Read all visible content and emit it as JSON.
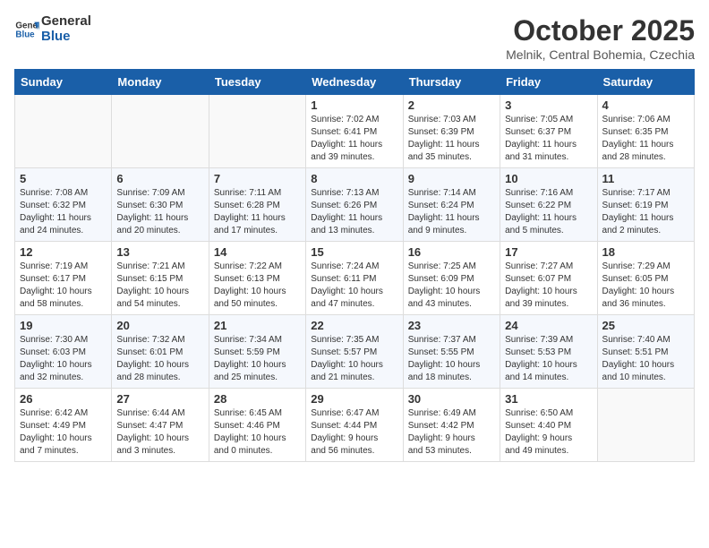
{
  "header": {
    "logo_line1": "General",
    "logo_line2": "Blue",
    "month_title": "October 2025",
    "subtitle": "Melnik, Central Bohemia, Czechia"
  },
  "weekdays": [
    "Sunday",
    "Monday",
    "Tuesday",
    "Wednesday",
    "Thursday",
    "Friday",
    "Saturday"
  ],
  "weeks": [
    [
      {
        "day": "",
        "info": ""
      },
      {
        "day": "",
        "info": ""
      },
      {
        "day": "",
        "info": ""
      },
      {
        "day": "1",
        "info": "Sunrise: 7:02 AM\nSunset: 6:41 PM\nDaylight: 11 hours\nand 39 minutes."
      },
      {
        "day": "2",
        "info": "Sunrise: 7:03 AM\nSunset: 6:39 PM\nDaylight: 11 hours\nand 35 minutes."
      },
      {
        "day": "3",
        "info": "Sunrise: 7:05 AM\nSunset: 6:37 PM\nDaylight: 11 hours\nand 31 minutes."
      },
      {
        "day": "4",
        "info": "Sunrise: 7:06 AM\nSunset: 6:35 PM\nDaylight: 11 hours\nand 28 minutes."
      }
    ],
    [
      {
        "day": "5",
        "info": "Sunrise: 7:08 AM\nSunset: 6:32 PM\nDaylight: 11 hours\nand 24 minutes."
      },
      {
        "day": "6",
        "info": "Sunrise: 7:09 AM\nSunset: 6:30 PM\nDaylight: 11 hours\nand 20 minutes."
      },
      {
        "day": "7",
        "info": "Sunrise: 7:11 AM\nSunset: 6:28 PM\nDaylight: 11 hours\nand 17 minutes."
      },
      {
        "day": "8",
        "info": "Sunrise: 7:13 AM\nSunset: 6:26 PM\nDaylight: 11 hours\nand 13 minutes."
      },
      {
        "day": "9",
        "info": "Sunrise: 7:14 AM\nSunset: 6:24 PM\nDaylight: 11 hours\nand 9 minutes."
      },
      {
        "day": "10",
        "info": "Sunrise: 7:16 AM\nSunset: 6:22 PM\nDaylight: 11 hours\nand 5 minutes."
      },
      {
        "day": "11",
        "info": "Sunrise: 7:17 AM\nSunset: 6:19 PM\nDaylight: 11 hours\nand 2 minutes."
      }
    ],
    [
      {
        "day": "12",
        "info": "Sunrise: 7:19 AM\nSunset: 6:17 PM\nDaylight: 10 hours\nand 58 minutes."
      },
      {
        "day": "13",
        "info": "Sunrise: 7:21 AM\nSunset: 6:15 PM\nDaylight: 10 hours\nand 54 minutes."
      },
      {
        "day": "14",
        "info": "Sunrise: 7:22 AM\nSunset: 6:13 PM\nDaylight: 10 hours\nand 50 minutes."
      },
      {
        "day": "15",
        "info": "Sunrise: 7:24 AM\nSunset: 6:11 PM\nDaylight: 10 hours\nand 47 minutes."
      },
      {
        "day": "16",
        "info": "Sunrise: 7:25 AM\nSunset: 6:09 PM\nDaylight: 10 hours\nand 43 minutes."
      },
      {
        "day": "17",
        "info": "Sunrise: 7:27 AM\nSunset: 6:07 PM\nDaylight: 10 hours\nand 39 minutes."
      },
      {
        "day": "18",
        "info": "Sunrise: 7:29 AM\nSunset: 6:05 PM\nDaylight: 10 hours\nand 36 minutes."
      }
    ],
    [
      {
        "day": "19",
        "info": "Sunrise: 7:30 AM\nSunset: 6:03 PM\nDaylight: 10 hours\nand 32 minutes."
      },
      {
        "day": "20",
        "info": "Sunrise: 7:32 AM\nSunset: 6:01 PM\nDaylight: 10 hours\nand 28 minutes."
      },
      {
        "day": "21",
        "info": "Sunrise: 7:34 AM\nSunset: 5:59 PM\nDaylight: 10 hours\nand 25 minutes."
      },
      {
        "day": "22",
        "info": "Sunrise: 7:35 AM\nSunset: 5:57 PM\nDaylight: 10 hours\nand 21 minutes."
      },
      {
        "day": "23",
        "info": "Sunrise: 7:37 AM\nSunset: 5:55 PM\nDaylight: 10 hours\nand 18 minutes."
      },
      {
        "day": "24",
        "info": "Sunrise: 7:39 AM\nSunset: 5:53 PM\nDaylight: 10 hours\nand 14 minutes."
      },
      {
        "day": "25",
        "info": "Sunrise: 7:40 AM\nSunset: 5:51 PM\nDaylight: 10 hours\nand 10 minutes."
      }
    ],
    [
      {
        "day": "26",
        "info": "Sunrise: 6:42 AM\nSunset: 4:49 PM\nDaylight: 10 hours\nand 7 minutes."
      },
      {
        "day": "27",
        "info": "Sunrise: 6:44 AM\nSunset: 4:47 PM\nDaylight: 10 hours\nand 3 minutes."
      },
      {
        "day": "28",
        "info": "Sunrise: 6:45 AM\nSunset: 4:46 PM\nDaylight: 10 hours\nand 0 minutes."
      },
      {
        "day": "29",
        "info": "Sunrise: 6:47 AM\nSunset: 4:44 PM\nDaylight: 9 hours\nand 56 minutes."
      },
      {
        "day": "30",
        "info": "Sunrise: 6:49 AM\nSunset: 4:42 PM\nDaylight: 9 hours\nand 53 minutes."
      },
      {
        "day": "31",
        "info": "Sunrise: 6:50 AM\nSunset: 4:40 PM\nDaylight: 9 hours\nand 49 minutes."
      },
      {
        "day": "",
        "info": ""
      }
    ]
  ]
}
